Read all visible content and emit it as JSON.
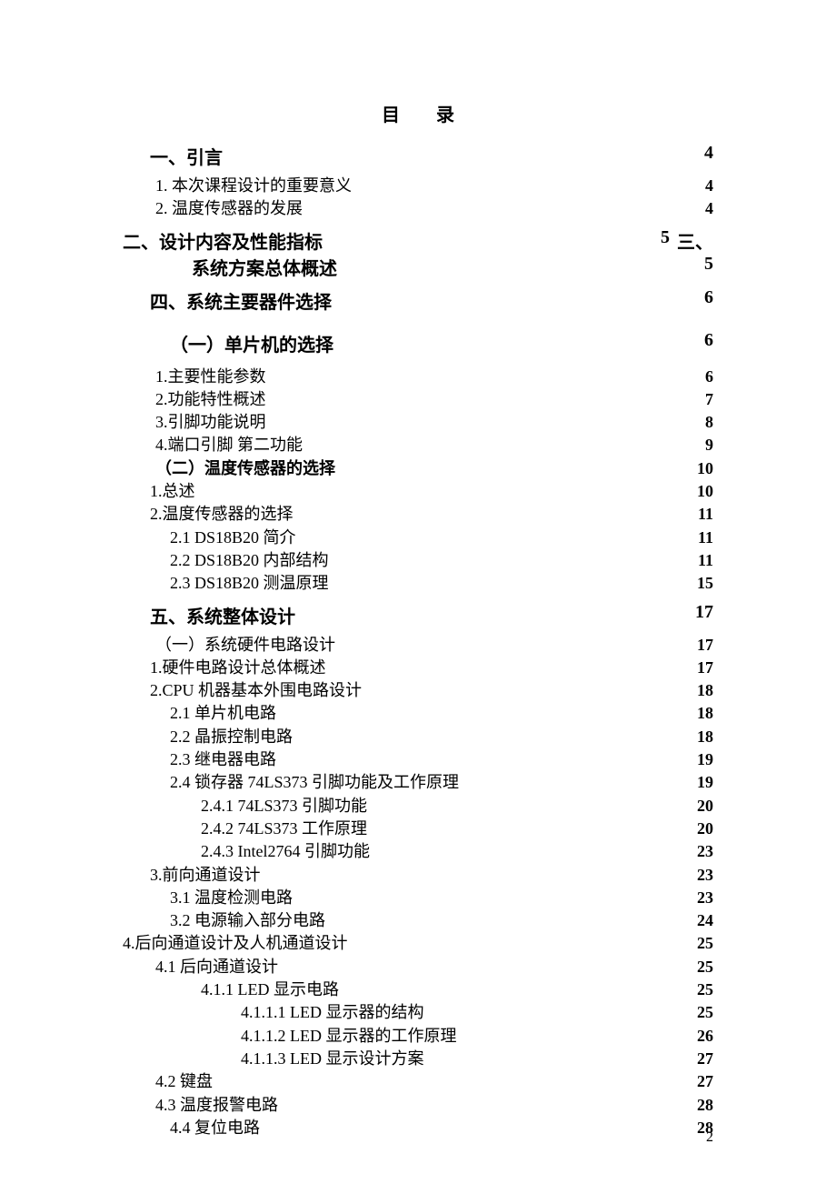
{
  "title": "目录",
  "page_number": "2",
  "toc": {
    "s1": {
      "label": "一、引言",
      "page": "4"
    },
    "s1_1": {
      "label": "1. 本次课程设计的重要意义",
      "page": "4"
    },
    "s1_2": {
      "label": "2. 温度传感器的发展",
      "page": "4"
    },
    "s2": {
      "label": "二、设计内容及性能指标",
      "page": "5"
    },
    "s3_suffix": "三、",
    "s3_line": {
      "label": "系统方案总体概述",
      "page": "5"
    },
    "s4": {
      "label": "四、系统主要器件选择",
      "page": "6"
    },
    "s4_a": {
      "label": "（一）单片机的选择",
      "page": "6"
    },
    "s4_a1": {
      "label": "1.主要性能参数",
      "page": "6"
    },
    "s4_a2": {
      "label": "2.功能特性概述",
      "page": "7"
    },
    "s4_a3": {
      "label": "3.引脚功能说明",
      "page": "8"
    },
    "s4_a4": {
      "label": "4.端口引脚  第二功能",
      "page": "9"
    },
    "s4_b": {
      "label": "（二）温度传感器的选择",
      "page": "10"
    },
    "s4_b1": {
      "label": "1.总述",
      "page": "10"
    },
    "s4_b2": {
      "label": "2.温度传感器的选择",
      "page": "11"
    },
    "s4_b21": {
      "label": "2.1 DS18B20 简介",
      "page": "11"
    },
    "s4_b22": {
      "label": "2.2 DS18B20 内部结构",
      "page": "11"
    },
    "s4_b23": {
      "label": "2.3 DS18B20 测温原理",
      "page": "15"
    },
    "s5": {
      "label": "五、系统整体设计",
      "page": "17"
    },
    "s5_a": {
      "label": "（一）系统硬件电路设计",
      "page": "17"
    },
    "s5_1": {
      "label": "1.硬件电路设计总体概述",
      "page": "17"
    },
    "s5_2": {
      "label": "2.CPU 机器基本外围电路设计",
      "page": "18"
    },
    "s5_21": {
      "label": "2.1 单片机电路",
      "page": "18"
    },
    "s5_22": {
      "label": "2.2 晶振控制电路",
      "page": "18"
    },
    "s5_23": {
      "label": "2.3 继电器电路",
      "page": "19"
    },
    "s5_24": {
      "label": "2.4 锁存器 74LS373 引脚功能及工作原理",
      "page": "19"
    },
    "s5_241": {
      "label": "2.4.1  74LS373 引脚功能",
      "page": "20"
    },
    "s5_242": {
      "label": "2.4.2  74LS373 工作原理",
      "page": "20"
    },
    "s5_243": {
      "label": "2.4.3 Intel2764 引脚功能",
      "page": "23"
    },
    "s5_3": {
      "label": "3.前向通道设计",
      "page": "23"
    },
    "s5_31": {
      "label": "3.1 温度检测电路",
      "page": "23"
    },
    "s5_32": {
      "label": "3.2 电源输入部分电路",
      "page": "24"
    },
    "s5_4": {
      "label": "4.后向通道设计及人机通道设计",
      "page": "25"
    },
    "s5_41": {
      "label": "4.1 后向通道设计",
      "page": "25"
    },
    "s5_411": {
      "label": "4.1.1  LED 显示电路",
      "page": "25"
    },
    "s5_4111": {
      "label": "4.1.1.1   LED 显示器的结构",
      "page": "25"
    },
    "s5_4112": {
      "label": "4.1.1.2   LED 显示器的工作原理",
      "page": "26"
    },
    "s5_4113": {
      "label": "4.1.1.3   LED 显示设计方案",
      "page": "27"
    },
    "s5_42": {
      "label": "4.2 键盘",
      "page": "27"
    },
    "s5_43": {
      "label": "4.3 温度报警电路",
      "page": "28"
    },
    "s5_44": {
      "label": "4.4 复位电路",
      "page": "28"
    }
  }
}
